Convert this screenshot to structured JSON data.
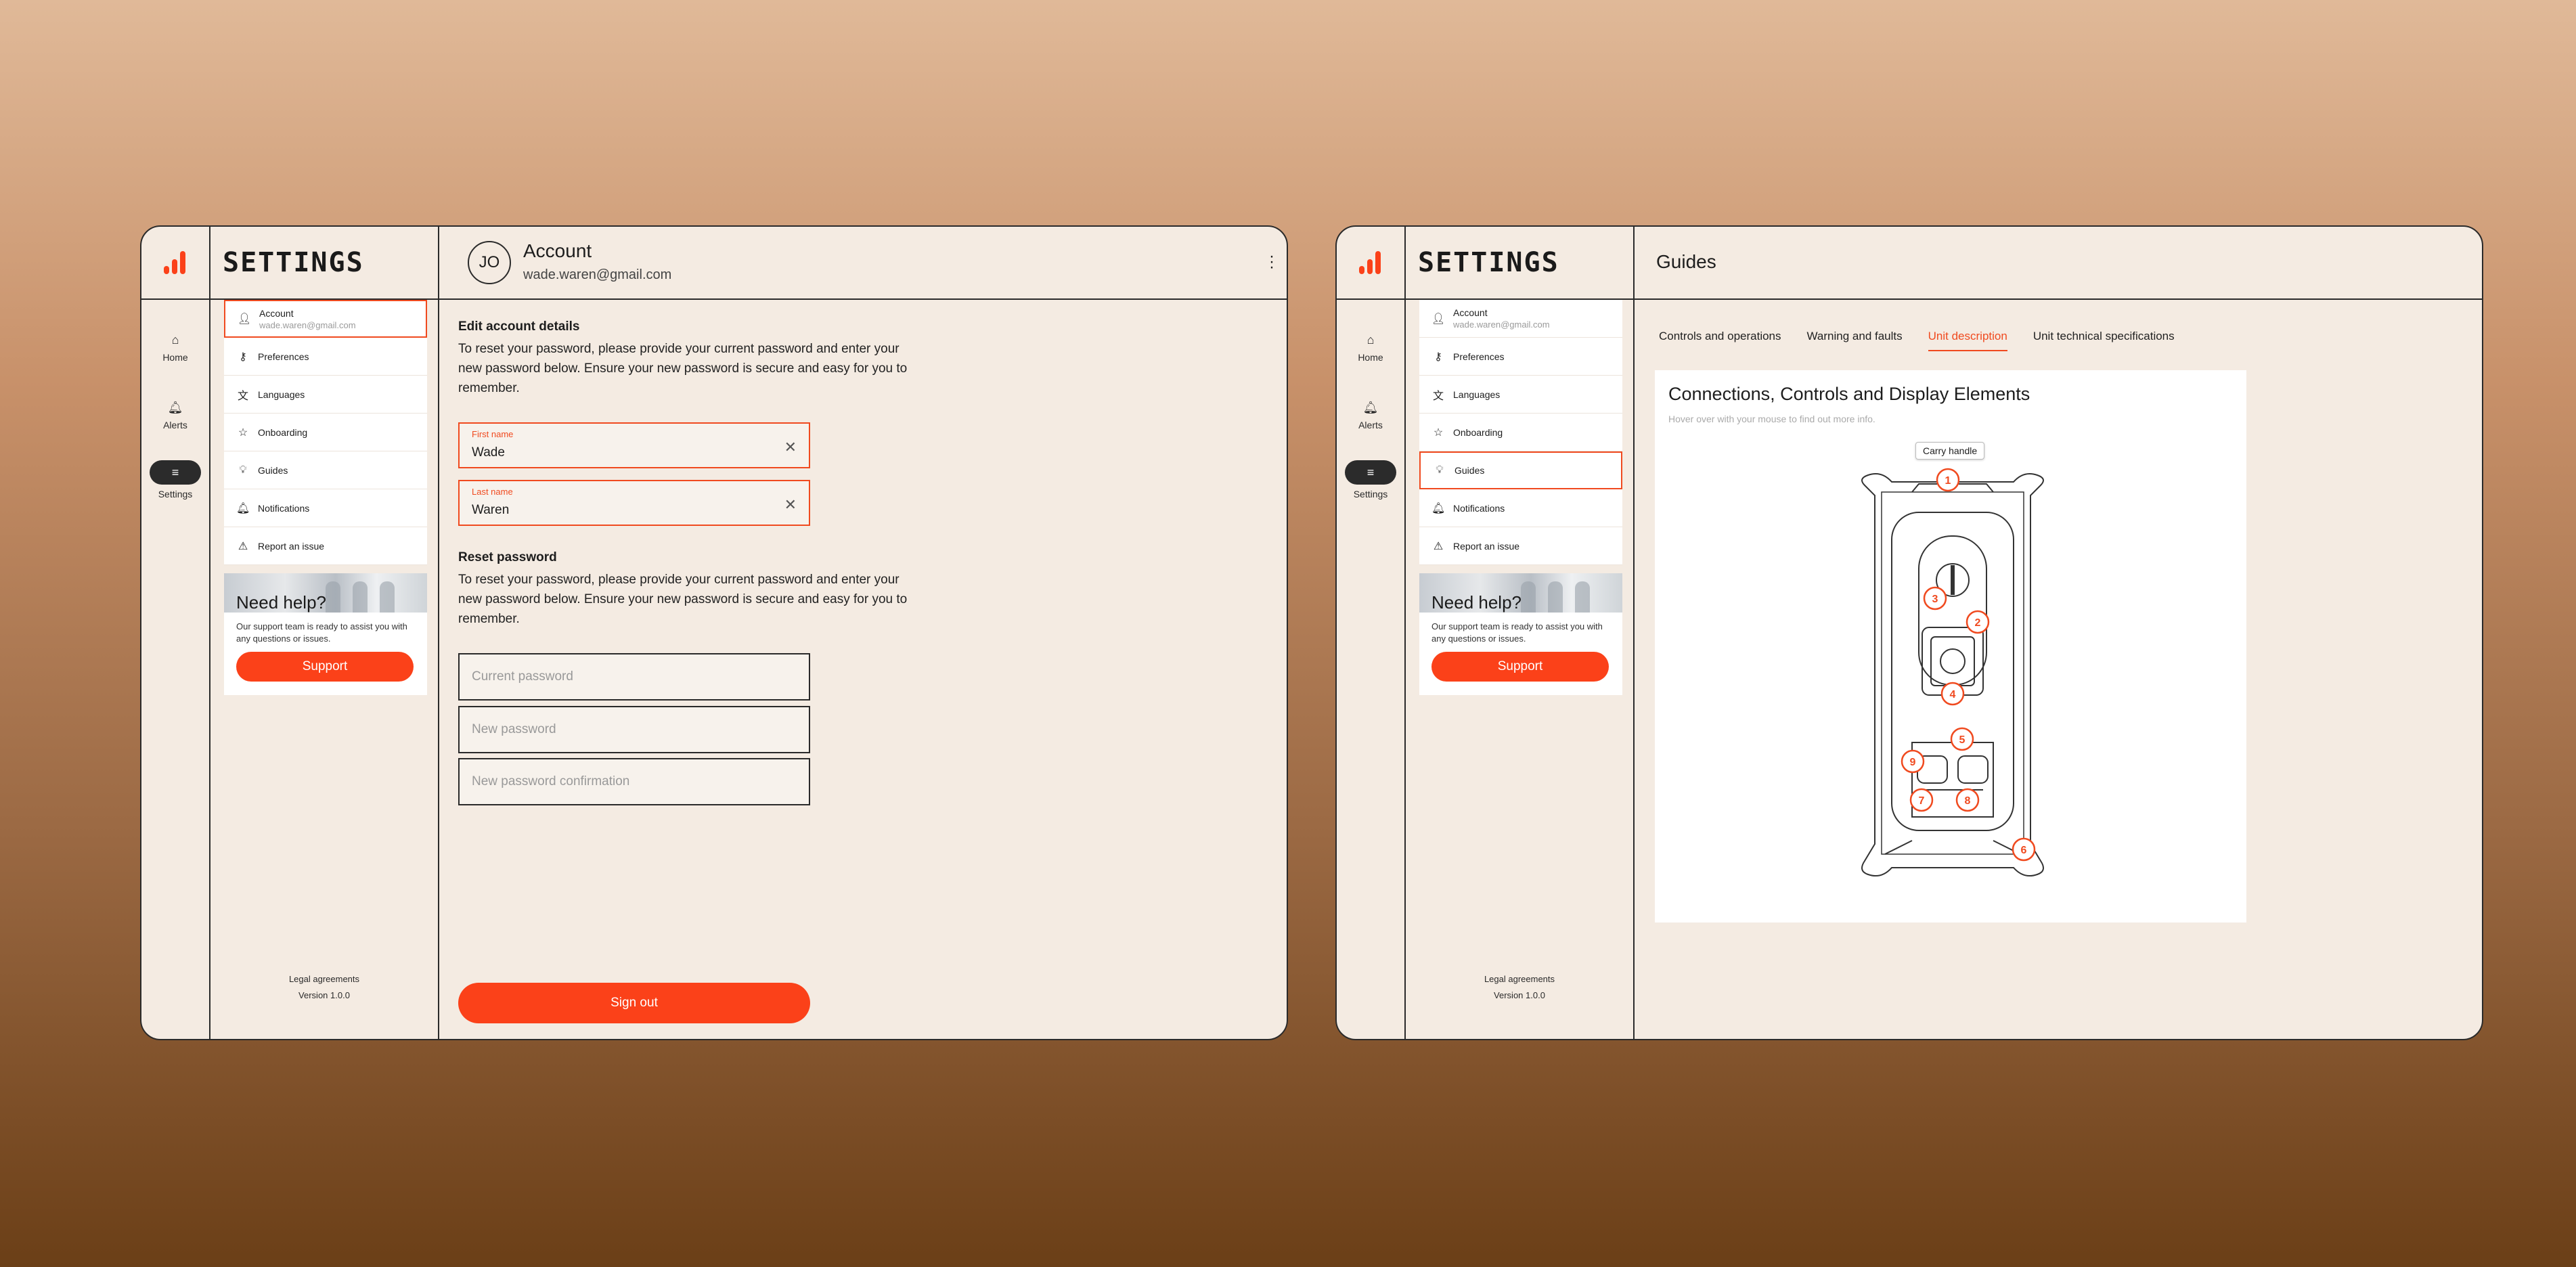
{
  "brand": {
    "accent": "#fb4119",
    "background": "#f4ebe2"
  },
  "rail": {
    "items": [
      {
        "label": "Home",
        "icon": "home-icon"
      },
      {
        "label": "Alerts",
        "icon": "bell-icon"
      },
      {
        "label": "Settings",
        "icon": "sliders-icon",
        "active": true
      }
    ]
  },
  "sidebar": {
    "title": "SETTINGS",
    "items": [
      {
        "label": "Account",
        "sub": "wade.waren@gmail.com",
        "icon": "user-icon"
      },
      {
        "label": "Preferences",
        "icon": "key-icon"
      },
      {
        "label": "Languages",
        "icon": "translate-icon"
      },
      {
        "label": "Onboarding",
        "icon": "star-icon"
      },
      {
        "label": "Guides",
        "icon": "lightbulb-icon"
      },
      {
        "label": "Notifications",
        "icon": "bell-icon"
      },
      {
        "label": "Report an issue",
        "icon": "warning-icon"
      }
    ],
    "help": {
      "title": "Need help?",
      "text": "Our support team is ready to assist you with any questions or issues.",
      "button": "Support"
    },
    "footer": {
      "legal": "Legal agreements",
      "version": "Version 1.0.0"
    }
  },
  "account": {
    "avatar_initials": "JO",
    "title": "Account",
    "email": "wade.waren@gmail.com",
    "edit_title": "Edit account details",
    "edit_text": "To reset your password, please provide your current password and enter your new password below. Ensure your new password is secure and easy for you to remember.",
    "first_name_label": "First name",
    "first_name_value": "Wade",
    "last_name_label": "Last name",
    "last_name_value": "Waren",
    "reset_title": "Reset password",
    "reset_text": "To reset your password, please provide your current password and enter your new password below. Ensure your new password is secure and easy for you to remember.",
    "current_pw_placeholder": "Current password",
    "new_pw_placeholder": "New password",
    "confirm_pw_placeholder": "New password confirmation",
    "signout": "Sign out"
  },
  "guides": {
    "title": "Guides",
    "tabs": [
      "Controls and operations",
      "Warning and faults",
      "Unit description",
      "Unit technical specifications"
    ],
    "active_tab": 2,
    "card_title": "Connections, Controls and Display Elements",
    "card_hint": "Hover over with your mouse to find out more info.",
    "tooltip": "Carry handle",
    "markers": [
      "1",
      "2",
      "3",
      "4",
      "5",
      "6",
      "7",
      "8",
      "9"
    ]
  }
}
